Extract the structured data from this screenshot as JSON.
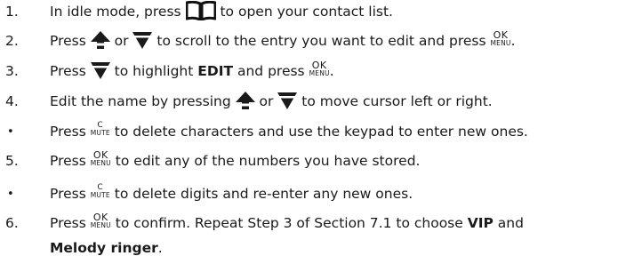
{
  "icons": {
    "contacts": "phonebook-book-icon",
    "up": "up-arrow-key-icon",
    "down": "down-arrow-key-icon"
  },
  "keys": {
    "ok_top": "OK",
    "ok_bottom": "MENU",
    "mute_top": "C",
    "mute_bottom": "MUTE"
  },
  "steps": [
    {
      "marker": "1.",
      "a": "In idle mode, press",
      "b": "to open your contact list."
    },
    {
      "marker": "2.",
      "a": "Press",
      "b": "or",
      "c": "to scroll to the entry you want to edit and press",
      "d": "."
    },
    {
      "marker": "3.",
      "a": "Press",
      "b": "to highlight",
      "bold": "EDIT",
      "c": "and press",
      "d": "."
    },
    {
      "marker": "4.",
      "a": "Edit the name by pressing",
      "b": "or",
      "c": "to move cursor left or right."
    },
    {
      "marker": "•",
      "a": "Press",
      "b": "to delete characters and use the keypad to enter new ones."
    },
    {
      "marker": "5.",
      "a": "Press",
      "b": "to edit any of the numbers you have stored."
    },
    {
      "marker": "•",
      "a": "Press",
      "b": "to delete digits and re-enter any new ones."
    },
    {
      "marker": "6.",
      "a": "Press",
      "b": "to confirm. Repeat Step 3 of Section 7.1 to choose",
      "bold": "VIP",
      "c": "and"
    },
    {
      "bold": "Melody ringer",
      "after": "."
    }
  ]
}
